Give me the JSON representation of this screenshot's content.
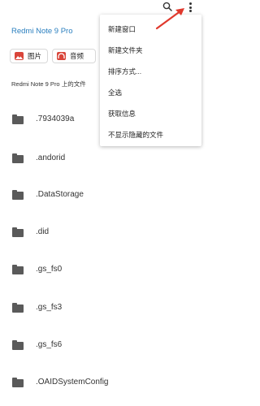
{
  "header": {
    "device_title": "Redmi Note 9 Pro",
    "search_icon": "search-icon",
    "more_icon": "more-vert-icon"
  },
  "chips": [
    {
      "label": "图片",
      "icon": "image-icon",
      "color": "#d9453a"
    },
    {
      "label": "音频",
      "icon": "headphones-icon",
      "color": "#d9453a"
    }
  ],
  "section_title": "Redmi Note 9 Pro 上的文件",
  "files": [
    {
      "name": ".7934039a",
      "icon": "folder-icon"
    },
    {
      "name": ".andorid",
      "icon": "folder-icon"
    },
    {
      "name": ".DataStorage",
      "icon": "folder-icon"
    },
    {
      "name": ".did",
      "icon": "folder-icon"
    },
    {
      "name": ".gs_fs0",
      "icon": "folder-icon"
    },
    {
      "name": ".gs_fs3",
      "icon": "folder-icon"
    },
    {
      "name": ".gs_fs6",
      "icon": "folder-icon"
    },
    {
      "name": ".OAIDSystemConfig",
      "icon": "folder-icon"
    }
  ],
  "menu": {
    "items": [
      "新建窗口",
      "新建文件夹",
      "排序方式...",
      "全选",
      "获取信息",
      "不显示隐藏的文件"
    ]
  },
  "annotation": {
    "color": "#e0382c",
    "icon": "arrow-annotation"
  }
}
